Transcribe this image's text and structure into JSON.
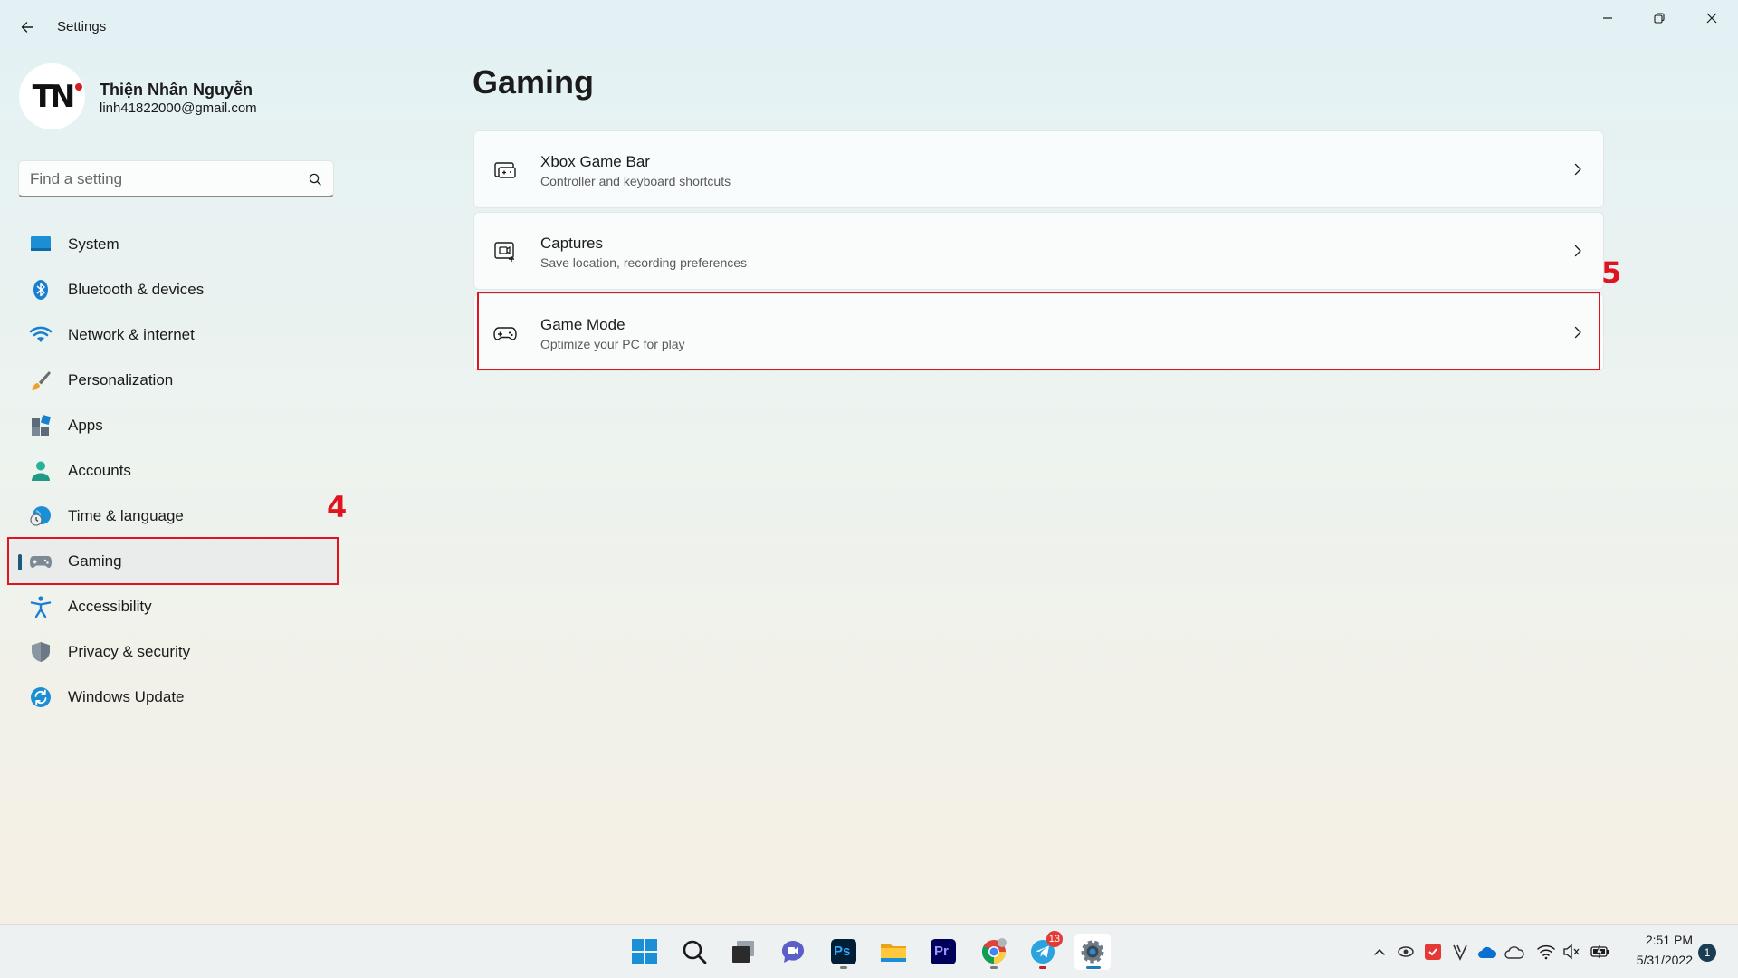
{
  "window": {
    "title": "Settings"
  },
  "profile": {
    "initials": "TN",
    "name": "Thiện Nhân Nguyễn",
    "email": "linh41822000@gmail.com"
  },
  "search": {
    "placeholder": "Find a setting"
  },
  "nav": {
    "items": [
      {
        "label": "System",
        "icon": "system-icon"
      },
      {
        "label": "Bluetooth & devices",
        "icon": "bluetooth-icon"
      },
      {
        "label": "Network & internet",
        "icon": "wifi-icon"
      },
      {
        "label": "Personalization",
        "icon": "brush-icon"
      },
      {
        "label": "Apps",
        "icon": "apps-icon"
      },
      {
        "label": "Accounts",
        "icon": "person-icon"
      },
      {
        "label": "Time & language",
        "icon": "globe-clock-icon"
      },
      {
        "label": "Gaming",
        "icon": "gamepad-icon",
        "selected": true
      },
      {
        "label": "Accessibility",
        "icon": "accessibility-icon"
      },
      {
        "label": "Privacy & security",
        "icon": "shield-icon"
      },
      {
        "label": "Windows Update",
        "icon": "update-icon"
      }
    ]
  },
  "annotations": {
    "step_nav": "4",
    "step_card": "5",
    "color": "#e0141e"
  },
  "main": {
    "title": "Gaming",
    "cards": [
      {
        "title": "Xbox Game Bar",
        "subtitle": "Controller and keyboard shortcuts",
        "icon": "game-bar-icon"
      },
      {
        "title": "Captures",
        "subtitle": "Save location, recording preferences",
        "icon": "capture-icon"
      },
      {
        "title": "Game Mode",
        "subtitle": "Optimize your PC for play",
        "icon": "gamepad-icon"
      }
    ]
  },
  "taskbar": {
    "apps": [
      {
        "name": "start-icon"
      },
      {
        "name": "search-icon"
      },
      {
        "name": "task-view-icon"
      },
      {
        "name": "chat-icon"
      },
      {
        "name": "photoshop-icon",
        "label": "Ps"
      },
      {
        "name": "file-explorer-icon"
      },
      {
        "name": "premiere-icon",
        "label": "Pr"
      },
      {
        "name": "chrome-icon"
      },
      {
        "name": "telegram-icon",
        "badge": "13"
      },
      {
        "name": "settings-icon"
      }
    ],
    "clock": {
      "time": "2:51 PM",
      "date": "5/31/2022"
    },
    "notifications": "1"
  },
  "colors": {
    "accent": "#1d5a7a",
    "annotation": "#e0141e"
  }
}
